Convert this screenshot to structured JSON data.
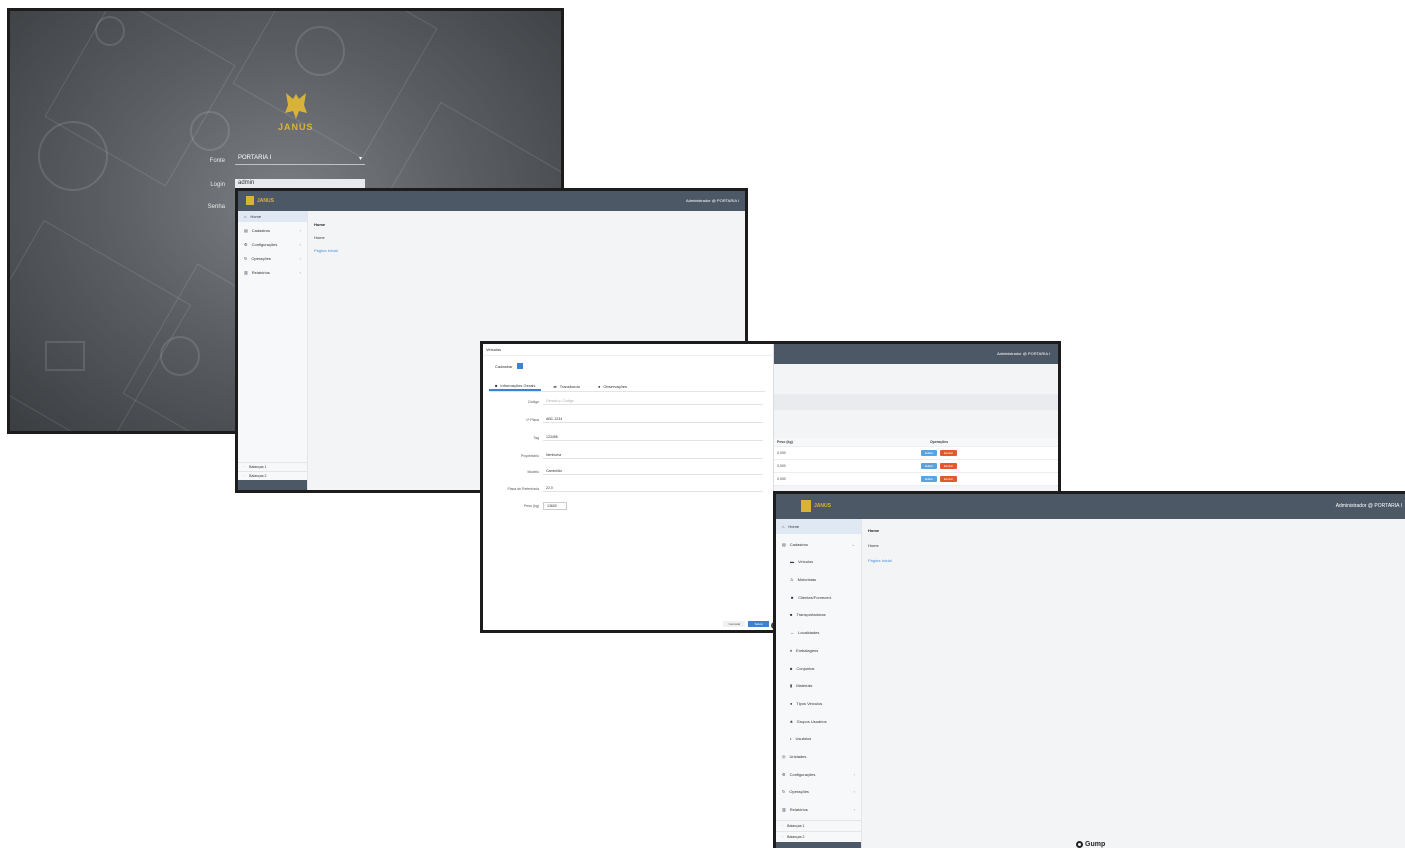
{
  "login": {
    "logo_text": "JANUS",
    "company_label": "Fonte",
    "company_value": "PORTARIA I",
    "login_label": "Login",
    "login_value": "admin",
    "password_label": "Senha"
  },
  "dashboard": {
    "user": "Administrador @ PORTARIA I",
    "brand": "JANUS",
    "nav": [
      {
        "label": "Home",
        "icon": "home-icon"
      },
      {
        "label": "Cadastros",
        "icon": "database-icon"
      },
      {
        "label": "Configurações",
        "icon": "gear-icon"
      },
      {
        "label": "Operações",
        "icon": "cycle-icon"
      },
      {
        "label": "Relatórios",
        "icon": "report-icon"
      }
    ],
    "bottom_items": [
      "Balanças 1",
      "Balanças 2"
    ],
    "crumb_title": "Home",
    "crumb_sub": "Home",
    "crumb_link": "Página Inicial"
  },
  "form": {
    "panel_title": "Veículos",
    "toggle_label": "Cadastrar",
    "tabs": [
      {
        "label": "Informações Gerais",
        "icon": "info-icon"
      },
      {
        "label": "Transbordo",
        "icon": "transfer-icon"
      },
      {
        "label": "Observações",
        "icon": "note-icon"
      }
    ],
    "fields": [
      {
        "label": "Código",
        "value": "Gerado p. Código",
        "placeholder": true
      },
      {
        "label": "1ª Placa",
        "value": "ABC-1234",
        "placeholder": false
      },
      {
        "label": "Tag",
        "value": "123456",
        "placeholder": false
      },
      {
        "label": "Proprietário",
        "value": "Nenhuma",
        "placeholder": false
      },
      {
        "label": "Modelo",
        "value": "Caminhão",
        "placeholder": false
      },
      {
        "label": "Placa de Referência",
        "value": "22,0",
        "placeholder": false
      },
      {
        "label": "Peso (kg)",
        "value": "13600",
        "placeholder": false
      }
    ],
    "cancel_label": "Cancelar",
    "save_label": "Salvar",
    "bg_user": "Administrador @ PORTARIA I",
    "bg_table": {
      "headers": [
        "Peso (kg)",
        "Operações"
      ],
      "rows": [
        [
          "0,000"
        ],
        [
          "0,000"
        ],
        [
          "0,000"
        ]
      ],
      "edit_label": "Editar",
      "delete_label": "Excluir"
    }
  },
  "menu": {
    "user": "Administrador @ PORTARIA I",
    "brand": "JANUS",
    "nav": [
      {
        "label": "Home",
        "icon": "home-icon",
        "sub": false,
        "active": true
      },
      {
        "label": "Cadastros",
        "icon": "database-icon",
        "sub": false,
        "active": false
      },
      {
        "label": "Veículos",
        "icon": "truck-icon",
        "sub": true,
        "active": false
      },
      {
        "label": "Motoristas",
        "icon": "driver-icon",
        "sub": true,
        "active": false
      },
      {
        "label": "Clientes/Forneced.",
        "icon": "user-icon",
        "sub": true,
        "active": false
      },
      {
        "label": "Transportadoras",
        "icon": "shipping-icon",
        "sub": true,
        "active": false
      },
      {
        "label": "Localidades",
        "icon": "location-icon",
        "sub": true,
        "active": false
      },
      {
        "label": "Embalagens",
        "icon": "package-icon",
        "sub": true,
        "active": false
      },
      {
        "label": "Conjuntos",
        "icon": "grid-icon",
        "sub": true,
        "active": false
      },
      {
        "label": "Materiais",
        "icon": "material-icon",
        "sub": true,
        "active": false
      },
      {
        "label": "Tipos Veículos",
        "icon": "list-icon",
        "sub": true,
        "active": false
      },
      {
        "label": "Grupos Usuários",
        "icon": "group-icon",
        "sub": true,
        "active": false
      },
      {
        "label": "Usuários",
        "icon": "person-icon",
        "sub": true,
        "active": false
      },
      {
        "label": "Unidades",
        "icon": "unit-icon",
        "sub": true,
        "active": false
      },
      {
        "label": "Configurações",
        "icon": "gear-icon",
        "sub": false,
        "active": false
      },
      {
        "label": "Operações",
        "icon": "cycle-icon",
        "sub": false,
        "active": false
      },
      {
        "label": "Relatórios",
        "icon": "report-icon",
        "sub": false,
        "active": false
      }
    ],
    "bottom_items": [
      "Balanças 1",
      "Balanças 2"
    ],
    "crumb_title": "Home",
    "crumb_sub": "Home",
    "crumb_link": "Página Inicial",
    "footer_logo": "Gump"
  }
}
